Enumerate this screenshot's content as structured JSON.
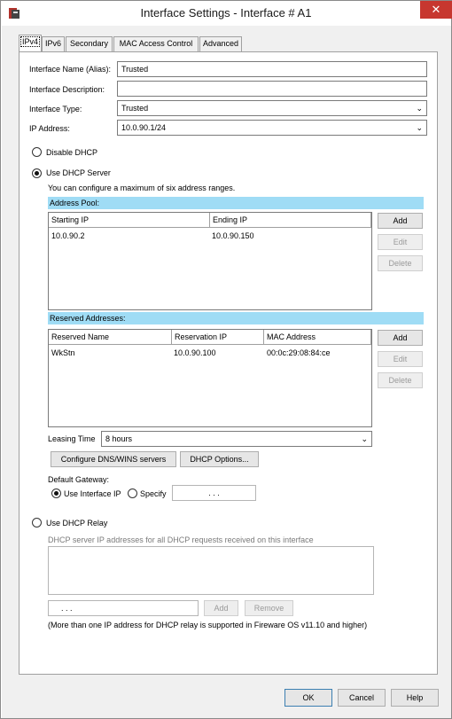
{
  "window": {
    "title": "Interface Settings - Interface # A1",
    "close_glyph": "✕"
  },
  "tabs": [
    {
      "label": "IPv4"
    },
    {
      "label": "IPv6"
    },
    {
      "label": "Secondary"
    },
    {
      "label": "MAC Access Control"
    },
    {
      "label": "Advanced"
    }
  ],
  "interface": {
    "name_label": "Interface Name (Alias):",
    "name_value": "Trusted",
    "description_label": "Interface Description:",
    "description_value": "",
    "type_label": "Interface Type:",
    "type_value": "Trusted",
    "ip_label": "IP Address:",
    "ip_value": "10.0.90.1/24"
  },
  "dhcp": {
    "disable_label": "Disable DHCP",
    "server_label": "Use DHCP Server",
    "server_note": "You can configure a maximum of six address ranges.",
    "address_pool_title": "Address Pool:",
    "address_pool_columns": [
      "Starting IP",
      "Ending IP"
    ],
    "address_pool_rows": [
      [
        "10.0.90.2",
        "10.0.90.150"
      ]
    ],
    "reserved_title": "Reserved Addresses:",
    "reserved_columns": [
      "Reserved Name",
      "Reservation IP",
      "MAC Address"
    ],
    "reserved_rows": [
      [
        "WkStn",
        "10.0.90.100",
        "00:0c:29:08:84:ce"
      ]
    ],
    "add_label": "Add",
    "edit_label": "Edit",
    "delete_label": "Delete",
    "leasing_label": "Leasing Time",
    "leasing_value": "8 hours",
    "dns_button": "Configure DNS/WINS servers",
    "options_button": "DHCP Options...",
    "gateway_label": "Default Gateway:",
    "gateway_interface_ip": "Use Interface IP",
    "gateway_specify": "Specify",
    "gateway_ip_placeholder": ".      .      ."
  },
  "relay": {
    "label": "Use DHCP Relay",
    "description": "DHCP server IP addresses for all DHCP requests received on this interface",
    "ip_placeholder": ".      .      .",
    "add_label": "Add",
    "remove_label": "Remove",
    "note": "(More than one IP address for DHCP relay is supported in Fireware OS v11.10 and higher)"
  },
  "footer": {
    "ok_label": "OK",
    "cancel_label": "Cancel",
    "help_label": "Help"
  },
  "icons": {
    "app": "firebox-app-icon",
    "chevron": "chevron-down-icon"
  },
  "colors": {
    "section_header": "#9fdcf5",
    "close_button": "#c7372f"
  }
}
